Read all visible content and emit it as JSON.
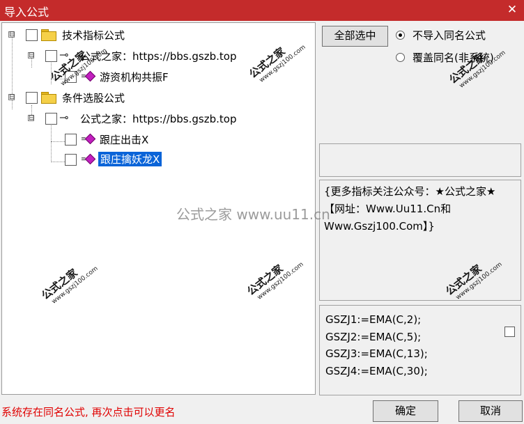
{
  "window": {
    "title": "导入公式",
    "close_glyph": "✕"
  },
  "tree": {
    "root1": {
      "label": "技术指标公式",
      "expander": "⊟"
    },
    "root1_child": {
      "label": "公式之家：https://bbs.gszb.top",
      "expander": "⊟"
    },
    "root1_leaf": {
      "label": "游资机构共振F"
    },
    "root2": {
      "label": "条件选股公式",
      "expander": "⊟"
    },
    "root2_child": {
      "label": "公式之家：https://bbs.gszb.top",
      "expander": "⊟"
    },
    "root2_leaf1": {
      "label": "跟庄出击X"
    },
    "root2_leaf2": {
      "label": "跟庄擒妖龙X",
      "selected": true
    }
  },
  "options": {
    "select_all_label": "全部选中",
    "radio_no_import": "不导入同名公式",
    "radio_overwrite": "覆盖同名(非系统)",
    "selected_radio": "radio_no_import"
  },
  "description": {
    "text": "{更多指标关注公众号：★公式之家★ 【网址：Www.Uu11.Cn和Www.Gszj100.Com】}"
  },
  "code": {
    "lines": [
      "GSZJ1:=EMA(C,2);",
      "GSZJ2:=EMA(C,5);",
      "GSZJ3:=EMA(C,13);",
      "GSZJ4:=EMA(C,30);"
    ]
  },
  "status": {
    "message": "系统存在同名公式, 再次点击可以更名"
  },
  "buttons": {
    "ok": "确定",
    "cancel": "取消"
  },
  "watermarks": {
    "overlay_text": "公式之家 www.uu11.cn",
    "stamp_title": "公式之家",
    "stamp_url": "www.gszj100.com"
  },
  "colors": {
    "titlebar": "#c42b2b",
    "selection": "#0a64d8",
    "status_text": "#e00000",
    "formula_gem": "#c21fbf"
  }
}
